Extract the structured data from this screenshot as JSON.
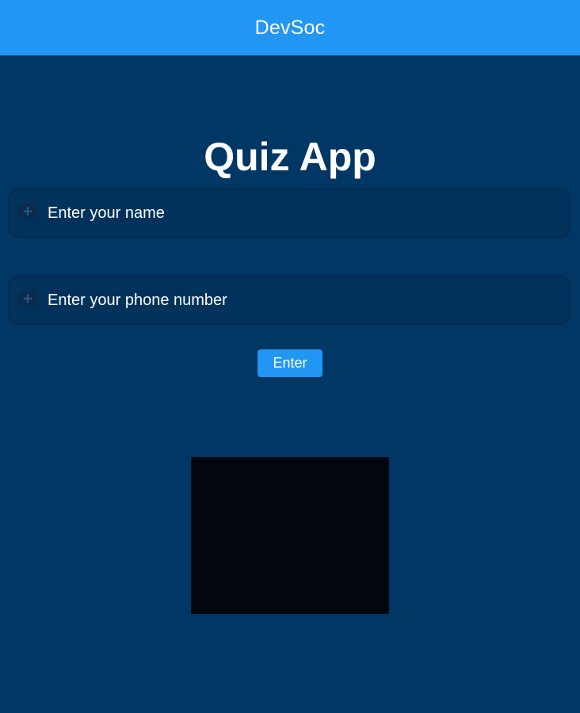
{
  "appbar": {
    "title": "DevSoc",
    "color": "#2196f3"
  },
  "main": {
    "title": "Quiz App",
    "background": "#003764"
  },
  "form": {
    "name_field": {
      "icon": "add-comment-icon",
      "value": "",
      "placeholder": "Enter your name"
    },
    "phone_field": {
      "icon": "add-comment-icon",
      "value": "",
      "placeholder": "Enter your phone number"
    },
    "enter_label": "Enter"
  },
  "media": {
    "placeholder_color": "#02070e"
  }
}
